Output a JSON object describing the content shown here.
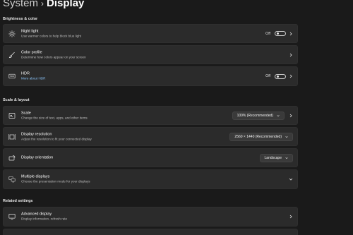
{
  "breadcrumb": {
    "parent": "System",
    "separator": "›",
    "current": "Display"
  },
  "sections": {
    "brightness_color": "Brightness & color",
    "scale_layout": "Scale & layout",
    "related": "Related settings"
  },
  "night_light": {
    "title": "Night light",
    "desc": "Use warmer colors to help block blue light",
    "state": "Off"
  },
  "color_profile": {
    "title": "Color profile",
    "desc": "Determine how colors appear on your screen"
  },
  "hdr": {
    "title": "HDR",
    "link": "More about HDR",
    "state": "Off"
  },
  "scale": {
    "title": "Scale",
    "desc": "Change the size of text, apps, and other items",
    "value": "100% (Recommended)"
  },
  "resolution": {
    "title": "Display resolution",
    "desc": "Adjust the resolution to fit your connected display",
    "value": "2560 × 1440 (Recommended)"
  },
  "orientation": {
    "title": "Display orientation",
    "value": "Landscape"
  },
  "multiple_displays": {
    "title": "Multiple displays",
    "desc": "Choose the presentation mode for your displays"
  },
  "advanced_display": {
    "title": "Advanced display",
    "desc": "Display information, refresh rate"
  },
  "icons": {
    "night_light": "sun-icon",
    "color_profile": "brush-icon",
    "hdr": "hdr-icon",
    "scale": "scale-icon",
    "resolution": "resolution-icon",
    "orientation": "orientation-icon",
    "multiple_displays": "multiple-displays-icon",
    "advanced_display": "monitor-icon"
  }
}
